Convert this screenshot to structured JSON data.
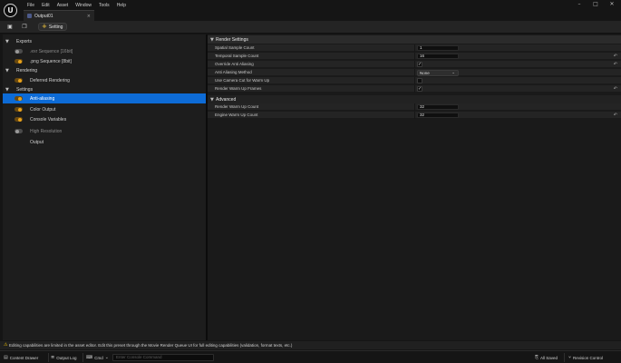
{
  "menu": [
    "File",
    "Edit",
    "Asset",
    "Window",
    "Tools",
    "Help"
  ],
  "document_tab": {
    "title": "Output01",
    "close": "×"
  },
  "toolbar": {
    "setting_label": "Setting"
  },
  "left_panel": {
    "categories": [
      {
        "label": "Exports",
        "caret": "▼"
      },
      {
        "label": "Rendering",
        "caret": "▼"
      },
      {
        "label": "Settings",
        "caret": "▼"
      }
    ],
    "items": [
      {
        "label": ".exr Sequence [16bit]",
        "enabled": false
      },
      {
        "label": ".png Sequence [8bit]",
        "enabled": true
      },
      {
        "label": "Deferred Rendering",
        "enabled": true
      },
      {
        "label": "Anti-aliasing",
        "enabled": true,
        "selected": true
      },
      {
        "label": "Color Output",
        "enabled": true
      },
      {
        "label": "Console Variables",
        "enabled": true
      },
      {
        "label": "High Resolution",
        "enabled": false
      },
      {
        "label": "Output",
        "enabled": null
      }
    ]
  },
  "details": {
    "render_settings": {
      "title": "Render Settings",
      "caret": "▼",
      "props": [
        {
          "label": "Spatial Sample Count",
          "type": "number",
          "value": "1",
          "reset": false
        },
        {
          "label": "Temporal Sample Count",
          "type": "number",
          "value": "16",
          "reset": true
        },
        {
          "label": "Override Anti Aliasing",
          "type": "checkbox",
          "checked": true,
          "reset": true
        },
        {
          "label": "Anti Aliasing Method",
          "type": "dropdown",
          "value": "None",
          "reset": false
        },
        {
          "label": "Use Camera Cut for Warm Up",
          "type": "checkbox",
          "checked": false,
          "reset": false
        },
        {
          "label": "Render Warm Up Frames",
          "type": "checkbox",
          "checked": true,
          "reset": true
        }
      ]
    },
    "advanced": {
      "title": "Advanced",
      "caret": "▼",
      "props": [
        {
          "label": "Render Warm Up Count",
          "type": "number",
          "value": "32",
          "reset": false
        },
        {
          "label": "Engine Warm Up Count",
          "type": "number",
          "value": "32",
          "reset": true
        }
      ]
    }
  },
  "warning": {
    "icon": "⚠",
    "text": "Editing capabilities are limited in the asset editor. Edit this preset through the Movie Render Queue UI for full editing capabilities (validation, format texts, etc.)"
  },
  "status_bar": {
    "content_drawer": "Content Drawer",
    "output_log": "Output Log",
    "cmd": "Cmd",
    "console_placeholder": "Enter Console Command",
    "all_saved": "All Saved",
    "revision_control": "Revision Control"
  },
  "window_controls": {
    "minimize": "–",
    "maximize": "□",
    "close": "✕"
  },
  "colors": {
    "accent_selection": "#0d6bd6",
    "toggle_on": "#e8a21c",
    "warning": "#e6b800"
  }
}
